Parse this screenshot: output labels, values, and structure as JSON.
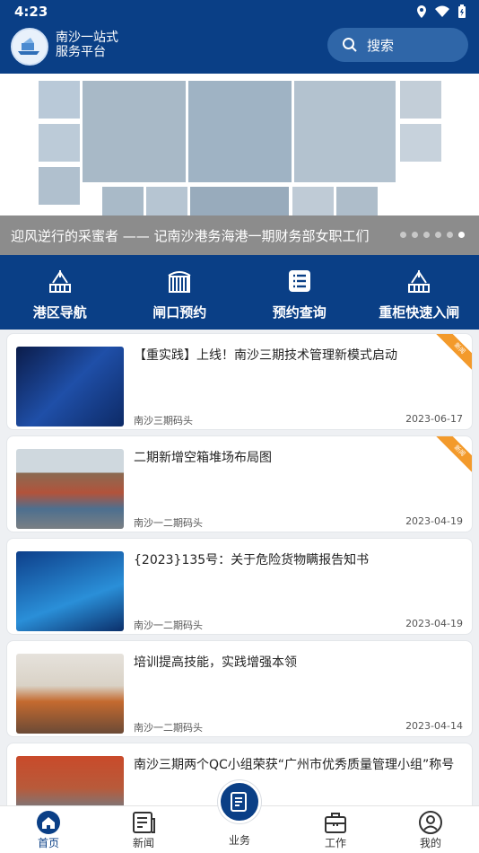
{
  "status": {
    "time": "4:23"
  },
  "header": {
    "app_name": "南沙一站式服务平台",
    "search_label": "搜索"
  },
  "banner": {
    "caption": "迎风逆行的采蜜者 —— 记南沙港务海港一期财务部女职工们",
    "dots_count": 6,
    "active_dot": 6
  },
  "quick_links": [
    {
      "label": "港区导航",
      "icon": "crane-icon"
    },
    {
      "label": "闸口预约",
      "icon": "gate-icon"
    },
    {
      "label": "预约查询",
      "icon": "list-icon"
    },
    {
      "label": "重柜快速入闸",
      "icon": "crane-icon"
    }
  ],
  "news": [
    {
      "title": "【重实践】上线！南沙三期技术管理新模式启动",
      "source": "南沙三期码头",
      "date": "2023-06-17",
      "badge": "新闻"
    },
    {
      "title": "二期新增空箱堆场布局图",
      "source": "南沙一二期码头",
      "date": "2023-04-19",
      "badge": "新闻"
    },
    {
      "title": "{2023}135号：关于危险货物瞒报告知书",
      "source": "南沙一二期码头",
      "date": "2023-04-19",
      "badge": ""
    },
    {
      "title": "培训提高技能，实践增强本领",
      "source": "南沙一二期码头",
      "date": "2023-04-14",
      "badge": ""
    },
    {
      "title": "南沙三期两个QC小组荣获“广州市优秀质量管理小组”称号",
      "source": "",
      "date": "",
      "badge": ""
    }
  ],
  "tabs": [
    {
      "label": "首页"
    },
    {
      "label": "新闻"
    },
    {
      "label": "业务"
    },
    {
      "label": "工作"
    },
    {
      "label": "我的"
    }
  ],
  "colors": {
    "primary": "#0a3f86",
    "badge": "#f39a2b"
  }
}
